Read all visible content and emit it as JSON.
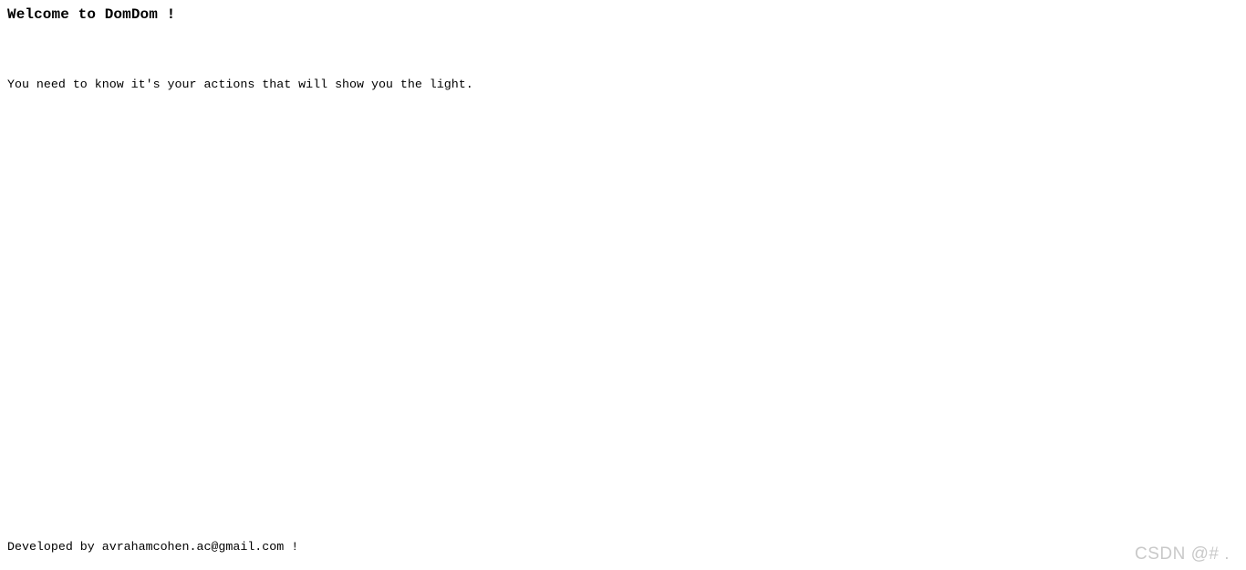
{
  "page": {
    "title": "DomDom",
    "background_color": "#ffffff",
    "text_color": "#000000"
  },
  "heading": {
    "text": "Welcome to DomDom !"
  },
  "body": {
    "intro_text": "You need to know it's your actions that will show you the light."
  },
  "footer": {
    "credit_text": "Developed by avrahamcohen.ac@gmail.com !",
    "email": "avrahamcohen.ac@gmail.com"
  },
  "watermark": {
    "text": "CSDN @# .",
    "color": "#c9c9c9"
  }
}
